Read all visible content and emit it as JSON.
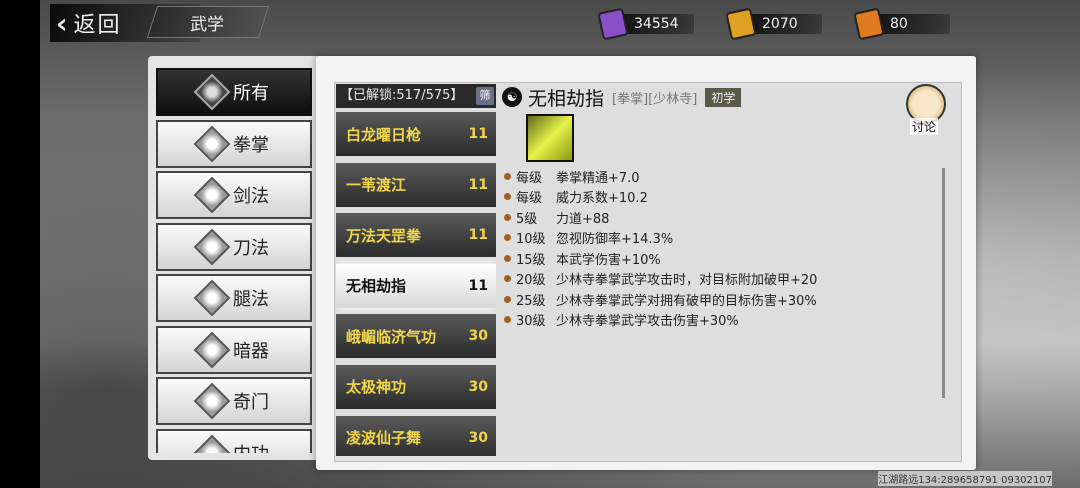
{
  "header": {
    "back_label": "返回",
    "title": "武学",
    "resources": [
      {
        "icon": "purple-ticket-icon",
        "value": "34554",
        "color": "#8a4fc8"
      },
      {
        "icon": "gold-ticket-icon",
        "value": "2070",
        "color": "#e0a020"
      },
      {
        "icon": "orange-ticket-icon",
        "value": "80",
        "color": "#e07a20"
      }
    ]
  },
  "categories": [
    {
      "label": "所有",
      "active": true
    },
    {
      "label": "拳掌"
    },
    {
      "label": "剑法"
    },
    {
      "label": "刀法"
    },
    {
      "label": "腿法"
    },
    {
      "label": "暗器"
    },
    {
      "label": "奇门"
    },
    {
      "label": "内功"
    }
  ],
  "skill_list": {
    "unlocked_text": "【已解锁:517/575】",
    "filter_label": "筛",
    "rows": [
      {
        "name": "白龙曜日枪",
        "level": "11"
      },
      {
        "name": "一苇渡江",
        "level": "11"
      },
      {
        "name": "万法天罡拳",
        "level": "11"
      },
      {
        "name": "无相劫指",
        "level": "11",
        "active": true
      },
      {
        "name": "峨嵋临济气功",
        "level": "30"
      },
      {
        "name": "太极神功",
        "level": "30"
      },
      {
        "name": "凌波仙子舞",
        "level": "30"
      }
    ]
  },
  "detail": {
    "title": "无相劫指",
    "tags": "[拳掌][少林寺]",
    "rank": "初学",
    "effects": [
      {
        "lv": "每级",
        "text": "拳掌精通+7.0"
      },
      {
        "lv": "每级",
        "text": "威力系数+10.2"
      },
      {
        "lv": "5级",
        "text": "力道+88"
      },
      {
        "lv": "10级",
        "text": "忽视防御率+14.3%"
      },
      {
        "lv": "15级",
        "text": "本武学伤害+10%"
      },
      {
        "lv": "20级",
        "text": "少林寺拳掌武学攻击时，对目标附加破甲+20"
      },
      {
        "lv": "25级",
        "text": "少林寺拳掌武学对拥有破甲的目标伤害+30%"
      },
      {
        "lv": "30级",
        "text": "少林寺拳掌武学攻击伤害+30%"
      }
    ],
    "discuss_label": "讨论"
  },
  "footer": {
    "id_text": "江湖路远134:289658791 09302107"
  }
}
